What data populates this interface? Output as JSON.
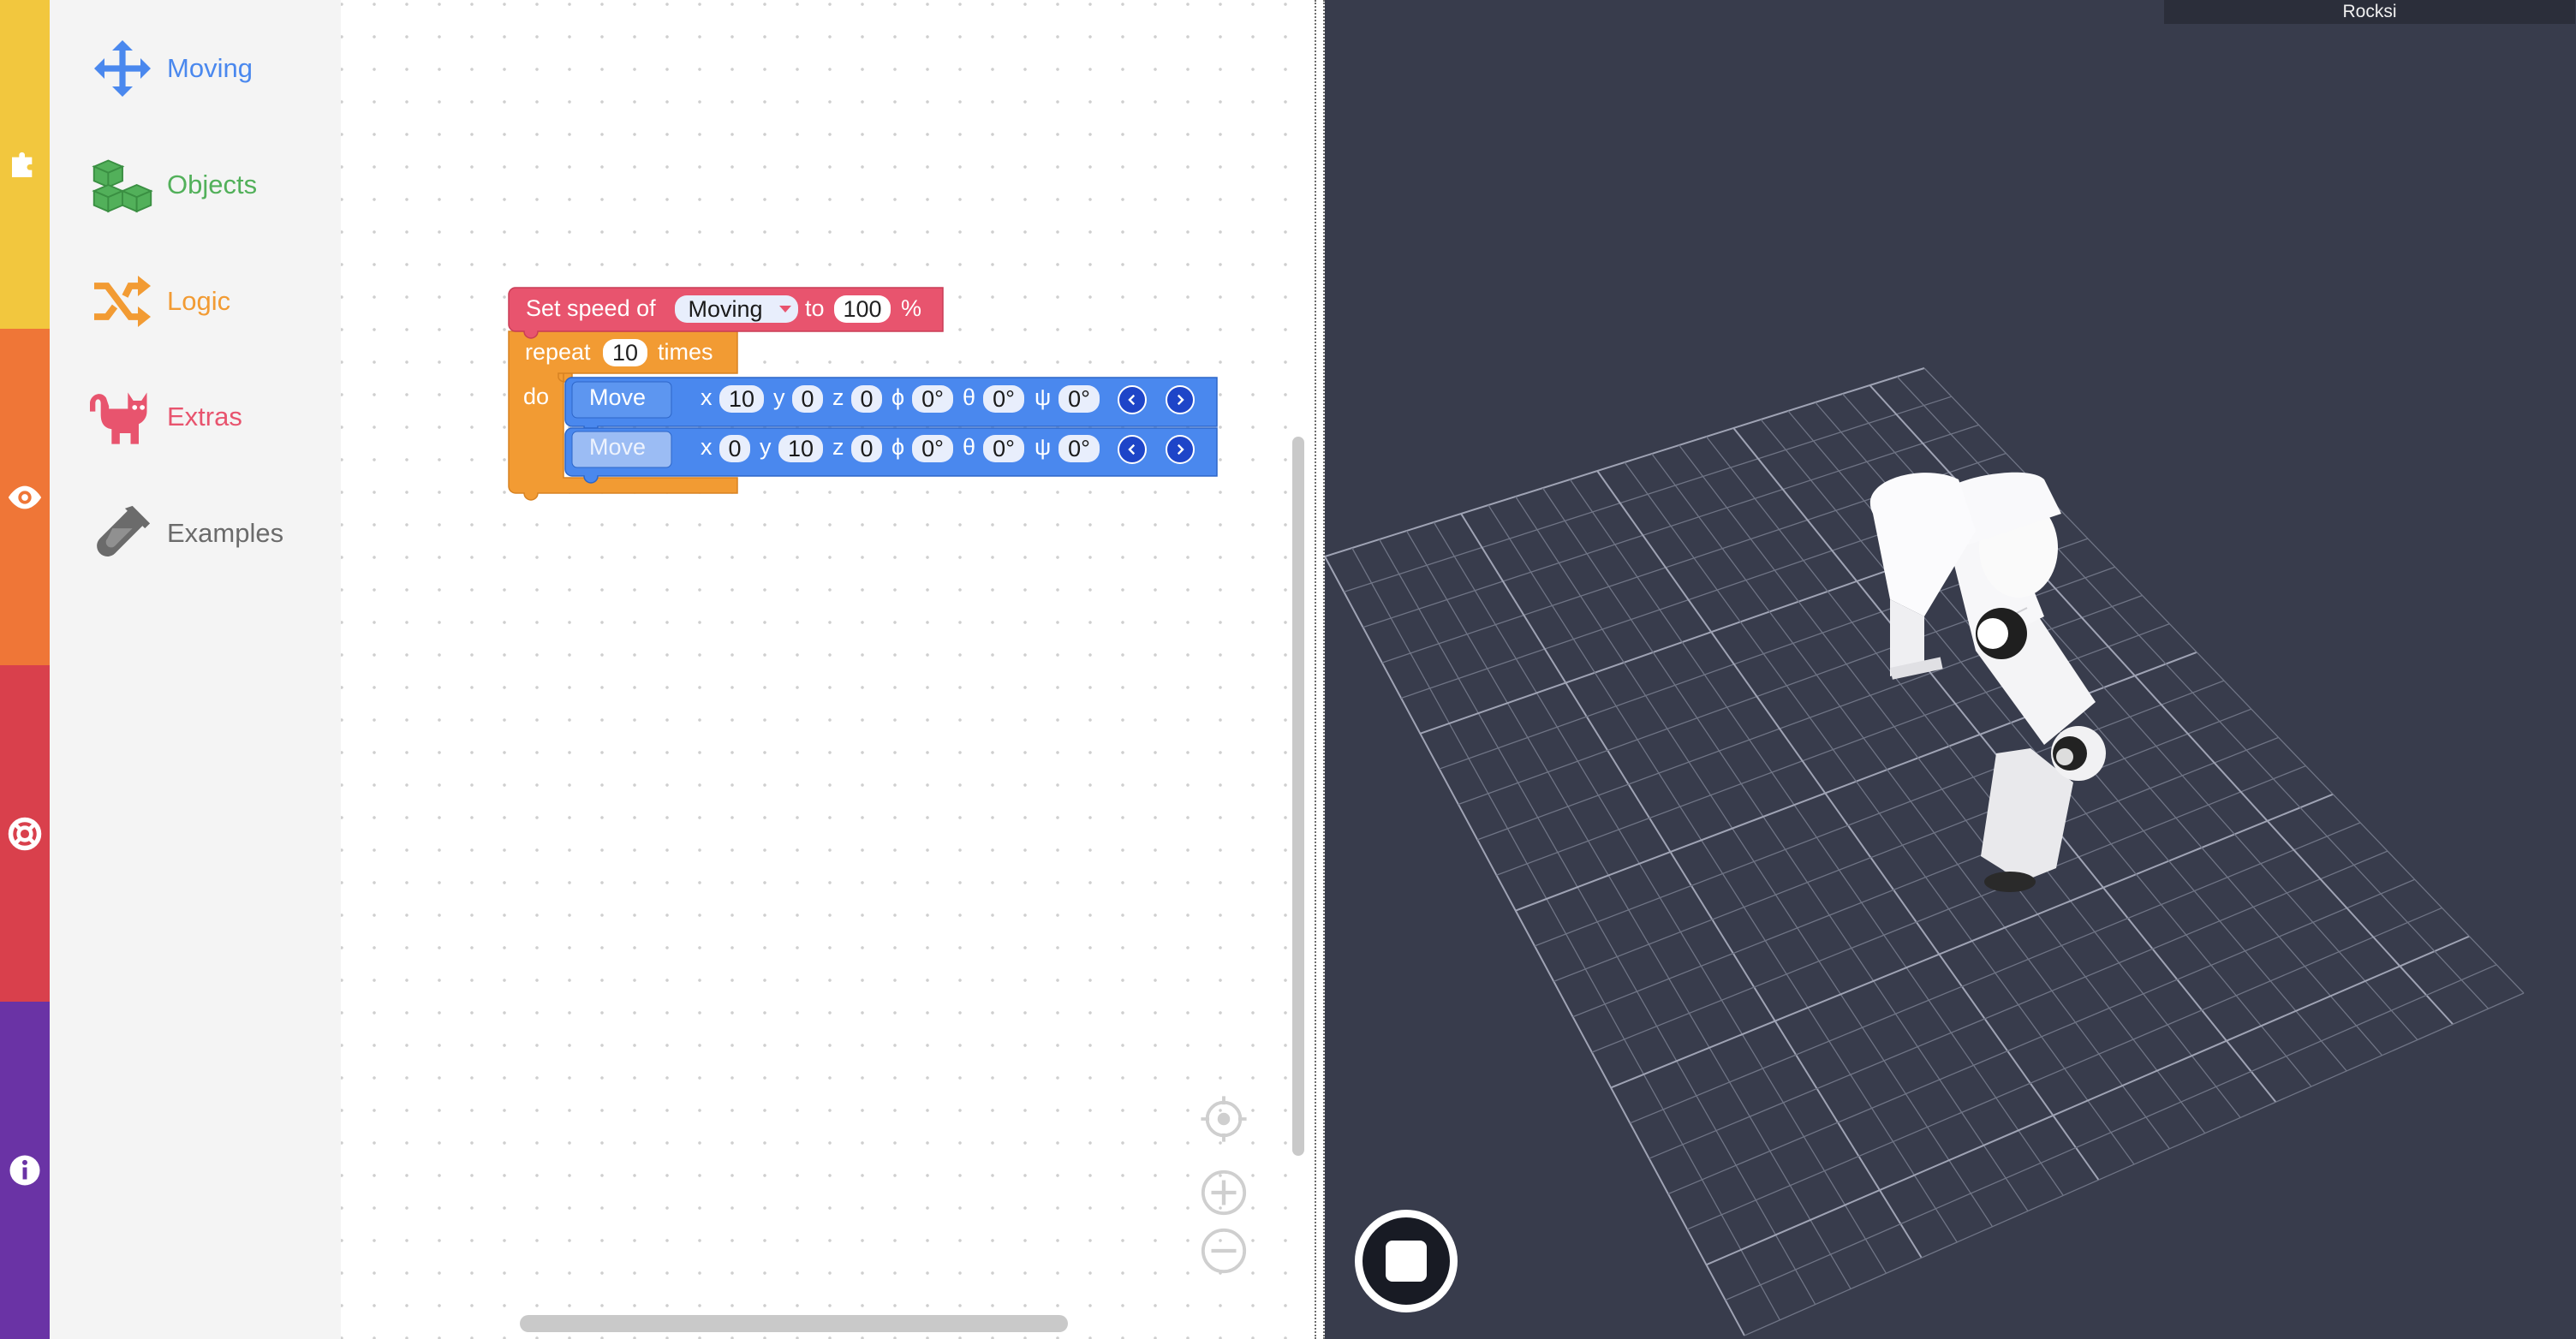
{
  "title": "Rocksi",
  "rail": {
    "colors": [
      "#f2c73e",
      "#ef7637",
      "#d9404c",
      "#6a33a5"
    ],
    "icons": [
      "puzzle-icon",
      "eye-icon",
      "lifebuoy-icon",
      "info-icon"
    ]
  },
  "toolbox": {
    "categories": [
      {
        "label": "Moving",
        "icon": "move-arrows-icon",
        "color": "#4a88ee"
      },
      {
        "label": "Objects",
        "icon": "cubes-icon",
        "color": "#52b05a"
      },
      {
        "label": "Logic",
        "icon": "shuffle-icon",
        "color": "#f29b33"
      },
      {
        "label": "Extras",
        "icon": "cat-icon",
        "color": "#e8546e"
      },
      {
        "label": "Examples",
        "icon": "test-tube-icon",
        "color": "#6b6b6b"
      }
    ]
  },
  "blocks": {
    "set_speed": {
      "prefix": "Set speed of",
      "dropdown": "Moving",
      "mid": "to",
      "value": "100",
      "suffix": "%"
    },
    "repeat": {
      "prefix": "repeat",
      "count": "10",
      "suffix": "times",
      "do": "do"
    },
    "moves": [
      {
        "label": "Move",
        "x": "10",
        "y": "0",
        "z": "0",
        "phi": "0°",
        "theta": "0°",
        "psi": "0°"
      },
      {
        "label": "Move",
        "x": "0",
        "y": "10",
        "z": "0",
        "phi": "0°",
        "theta": "0°",
        "psi": "0°"
      }
    ],
    "axis_labels": {
      "x": "x",
      "y": "y",
      "z": "z",
      "phi": "ϕ",
      "theta": "θ",
      "psi": "ψ"
    }
  },
  "colors": {
    "speed_block": "#e8546e",
    "repeat_block": "#f29b33",
    "move_block": "#4a88ee",
    "viewport_bg": "#383c4c"
  }
}
